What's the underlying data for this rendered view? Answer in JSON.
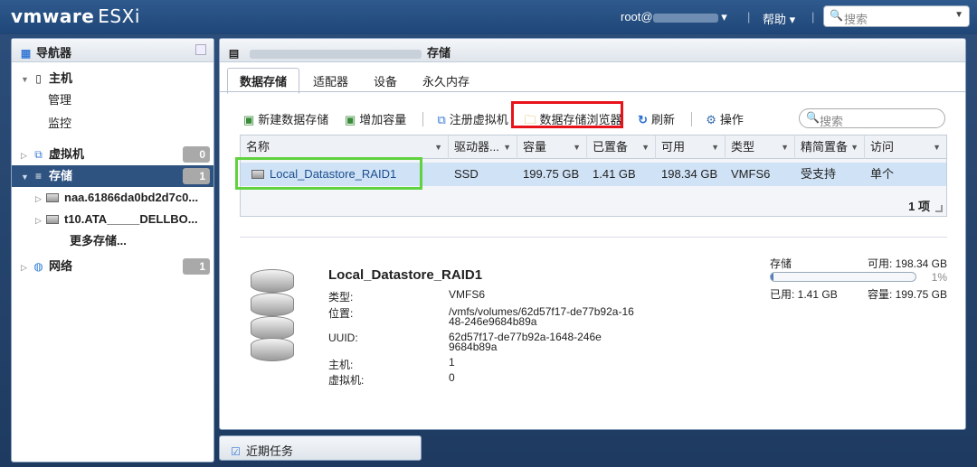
{
  "header": {
    "brand": "vmware",
    "product": "ESXi",
    "user": "root@",
    "help": "帮助",
    "search_placeholder": "搜索"
  },
  "navigator": {
    "title": "导航器",
    "host": "主机",
    "manage": "管理",
    "monitor": "监控",
    "vms": "虚拟机",
    "vms_count": "0",
    "storage": "存储",
    "storage_count": "1",
    "devices": [
      "naa.61866da0bd2d7c0...",
      "t10.ATA_____DELLBO..."
    ],
    "more_storage": "更多存储...",
    "network": "网络",
    "network_count": "1"
  },
  "main": {
    "title_suffix": "存储",
    "tabs": [
      "数据存储",
      "适配器",
      "设备",
      "永久内存"
    ],
    "toolbar": {
      "new_datastore": "新建数据存储",
      "increase_capacity": "增加容量",
      "register_vm": "注册虚拟机",
      "datastore_browser": "数据存储浏览器",
      "refresh": "刷新",
      "actions": "操作"
    },
    "search_placeholder": "搜索",
    "columns": [
      "名称",
      "驱动器...",
      "容量",
      "已置备",
      "可用",
      "类型",
      "精简置备",
      "访问"
    ],
    "row": [
      "Local_Datastore_RAID1",
      "SSD",
      "199.75 GB",
      "1.41 GB",
      "198.34 GB",
      "VMFS6",
      "受支持",
      "单个"
    ],
    "count": "1 项"
  },
  "details": {
    "name": "Local_Datastore_RAID1",
    "type_label": "类型:",
    "type_value": "VMFS6",
    "location_label": "位置:",
    "location_value": "/vmfs/volumes/62d57f17-de77b92a-1648-246e9684b89a",
    "uuid_label": "UUID:",
    "uuid_value": "62d57f17-de77b92a-1648-246e9684b89a",
    "hosts_label": "主机:",
    "hosts_value": "1",
    "vms_label": "虚拟机:",
    "vms_value": "0"
  },
  "capacity": {
    "storage_label": "存储",
    "free": "可用: 198.34 GB",
    "percent_text": "1%",
    "used_fraction": 0.01,
    "used": "已用: 1.41 GB",
    "capacity": "容量: 199.75 GB"
  },
  "recent_tasks": "近期任务"
}
